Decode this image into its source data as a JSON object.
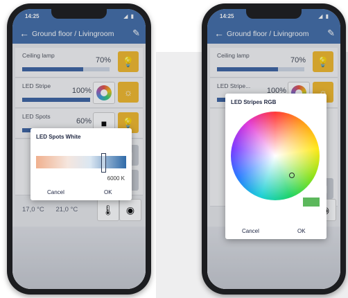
{
  "left_phone": {
    "status": {
      "time": "14:25",
      "icons": "◢ ▮"
    },
    "appbar": {
      "title": "Ground floor / Livingroom"
    },
    "rows": [
      {
        "label": "Ceiling lamp",
        "percent": "70%",
        "level": 0.7
      },
      {
        "label": "LED Stripe",
        "percent": "100%",
        "level": 1.0
      },
      {
        "label": "LED Spots",
        "percent": "60%",
        "level": 0.6
      }
    ],
    "temps": {
      "t1": "17,0 °C",
      "t2": "21,0 °C"
    },
    "dialog": {
      "title": "LED Spots  White",
      "kelvin": "6000 K",
      "cancel": "Cancel",
      "ok": "OK",
      "slider_level": 0.78
    }
  },
  "right_phone": {
    "status": {
      "time": "14:25",
      "icons": "◢ ▮"
    },
    "appbar": {
      "title": "Ground floor / Livingroom"
    },
    "rows": [
      {
        "label": "Ceiling lamp",
        "percent": "70%",
        "level": 0.7
      },
      {
        "label": "LED Stripe...",
        "percent": "100%",
        "level": 1.0
      }
    ],
    "dialog": {
      "title": "LED Stripes RGB",
      "cancel": "Cancel",
      "ok": "OK",
      "swatch_color": "#5cb85c"
    }
  },
  "colors": {
    "accent": "#3d6aa6",
    "tile_yellow": "#f2b826"
  }
}
